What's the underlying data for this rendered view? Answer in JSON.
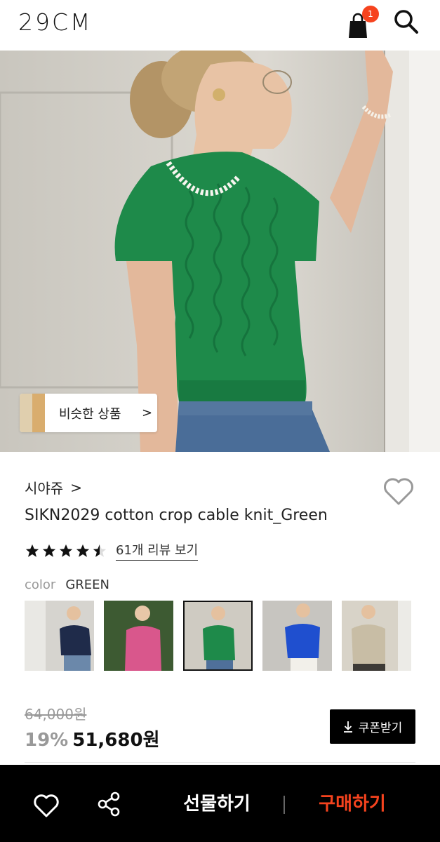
{
  "header": {
    "logo": "29CM",
    "cart_count": "1",
    "icons": [
      "shopping-bag-icon",
      "search-icon"
    ]
  },
  "hero": {
    "similar_label": "비슷한 상품",
    "similar_chevron": ">"
  },
  "product": {
    "brand": "시야쥬",
    "brand_chevron": ">",
    "title": "SIKN2029 cotton crop cable knit_Green",
    "rating": 4.5,
    "review_link": "61개 리뷰 보기",
    "color_label": "color",
    "color_value": "GREEN",
    "swatches": [
      {
        "name": "navy",
        "hex": "#1f2b4a",
        "selected": false
      },
      {
        "name": "pink",
        "hex": "#d9578c",
        "selected": false
      },
      {
        "name": "green",
        "hex": "#1e8a4a",
        "selected": true
      },
      {
        "name": "blue",
        "hex": "#1f4fcf",
        "selected": false
      },
      {
        "name": "beige",
        "hex": "#c8bda5",
        "selected": false
      }
    ],
    "original_price": "64,000원",
    "discount": "19%",
    "price": "51,680원",
    "coupon_label": "쿠폰받기"
  },
  "bottom_bar": {
    "gift_label": "선물하기",
    "buy_label": "구매하기"
  },
  "colors": {
    "accent": "#f6431e",
    "product_green": "#1e8a4a"
  }
}
